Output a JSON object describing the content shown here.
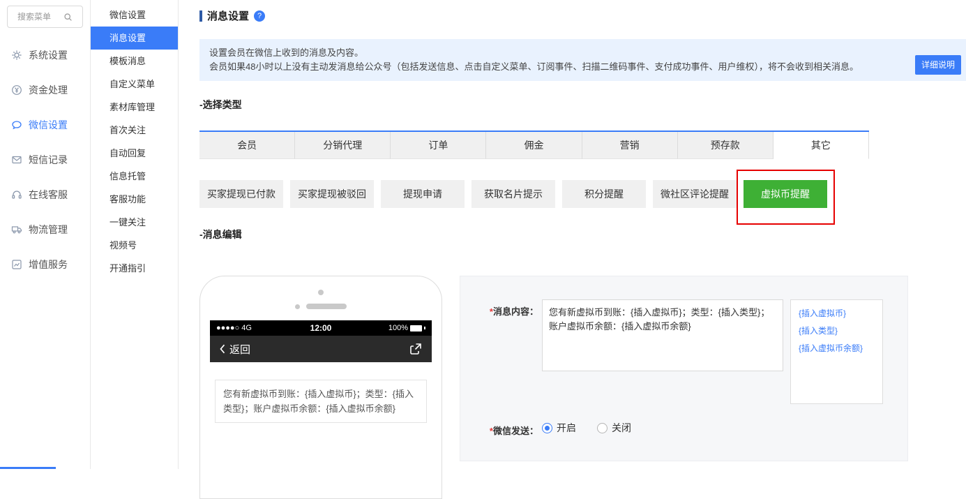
{
  "colors": {
    "primary": "#3a7cf8",
    "active_green": "#3eb035",
    "annotation_red": "#e60000",
    "notice_bg": "#e9f2fe"
  },
  "icons": {
    "search": "magnifier",
    "system_settings": "gear",
    "funds": "yen-circle",
    "wechat": "chat-bubble",
    "sms": "envelope",
    "service": "headset",
    "logistics": "truck",
    "value_added": "line-chart",
    "help": "question-circle",
    "back": "chevron-left",
    "share": "share-arrow",
    "battery": "battery-full"
  },
  "sidebar": {
    "search_placeholder": "搜索菜单",
    "active_item": "微信设置",
    "items": [
      {
        "label": "系统设置"
      },
      {
        "label": "资金处理"
      },
      {
        "label": "微信设置"
      },
      {
        "label": "短信记录"
      },
      {
        "label": "在线客服"
      },
      {
        "label": "物流管理"
      },
      {
        "label": "增值服务"
      }
    ]
  },
  "submenu": {
    "active_item": "消息设置",
    "items": [
      {
        "label": "微信设置"
      },
      {
        "label": "消息设置"
      },
      {
        "label": "模板消息"
      },
      {
        "label": "自定义菜单"
      },
      {
        "label": "素材库管理"
      },
      {
        "label": "首次关注"
      },
      {
        "label": "自动回复"
      },
      {
        "label": "信息托管"
      },
      {
        "label": "客服功能"
      },
      {
        "label": "一键关注"
      },
      {
        "label": "视频号"
      },
      {
        "label": "开通指引"
      }
    ]
  },
  "header": {
    "title": "消息设置",
    "help_glyph": "?"
  },
  "notice": {
    "line1": "设置会员在微信上收到的消息及内容。",
    "line2": "会员如果48小时以上没有主动发消息给公众号（包括发送信息、点击自定义菜单、订阅事件、扫描二维码事件、支付成功事件、用户维权），将不会收到相关消息。",
    "detail_button": "详细说明"
  },
  "sections": {
    "select_type": "-选择类型",
    "message_edit": "-消息编辑"
  },
  "tabs": {
    "active": "其它",
    "items": [
      {
        "label": "会员"
      },
      {
        "label": "分销代理"
      },
      {
        "label": "订单"
      },
      {
        "label": "佣金"
      },
      {
        "label": "营销"
      },
      {
        "label": "预存款"
      },
      {
        "label": "其它"
      }
    ]
  },
  "type_buttons": {
    "active": "虚拟币提醒",
    "items": [
      {
        "label": "买家提现已付款"
      },
      {
        "label": "买家提现被驳回"
      },
      {
        "label": "提现申请"
      },
      {
        "label": "获取名片提示"
      },
      {
        "label": "积分提醒"
      },
      {
        "label": "微社区评论提醒"
      },
      {
        "label": "虚拟币提醒"
      }
    ]
  },
  "phone": {
    "signal": "●●●●○ 4G",
    "time": "12:00",
    "battery": "100%",
    "back_label": "返回",
    "message": "您有新虚拟币到账：{插入虚拟币}；类型：{插入类型}；账户虚拟币余额：{插入虚拟币余额}"
  },
  "form": {
    "required_mark": "*",
    "content_label": "消息内容：",
    "content_value": "您有新虚拟币到账：{插入虚拟币}；类型：{插入类型}； 账户虚拟币余额：{插入虚拟币余额}",
    "insert_links": [
      {
        "label": "{插入虚拟币}"
      },
      {
        "label": "{插入类型}"
      },
      {
        "label": "{插入虚拟币余额}"
      }
    ],
    "send_label": "微信发送：",
    "selected_option": "开启",
    "options": [
      {
        "label": "开启"
      },
      {
        "label": "关闭"
      }
    ]
  }
}
